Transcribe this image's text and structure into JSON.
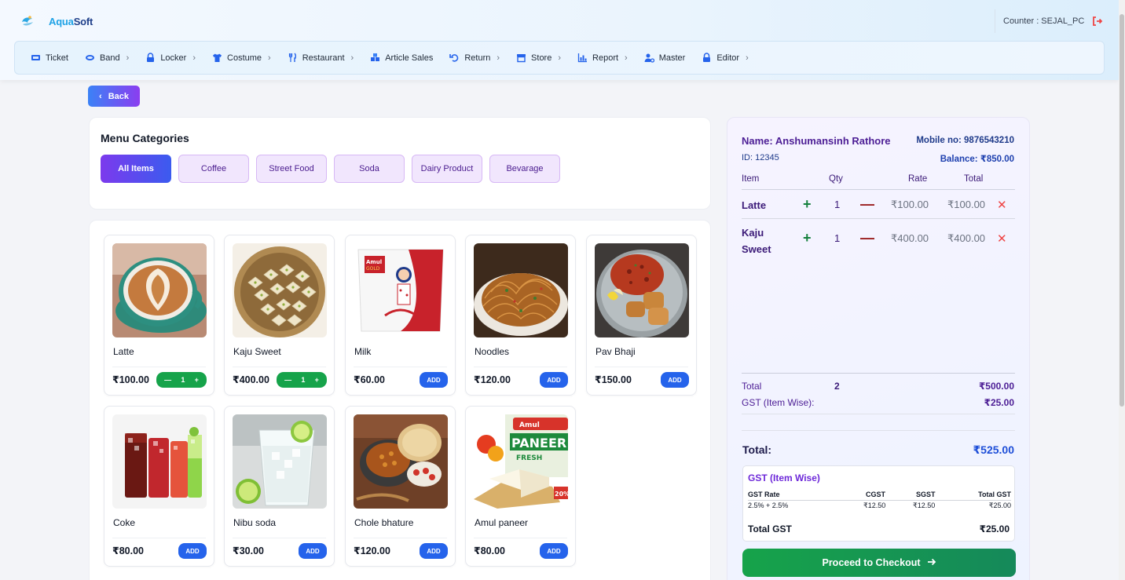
{
  "brand": {
    "aqua": "Aqua",
    "soft": "Soft"
  },
  "counter": {
    "label": "Counter : SEJAL_PC"
  },
  "nav": [
    {
      "label": "Ticket",
      "icon": "ticket-icon",
      "chevron": false
    },
    {
      "label": "Band",
      "icon": "band-icon",
      "chevron": true
    },
    {
      "label": "Locker",
      "icon": "lock-icon",
      "chevron": true
    },
    {
      "label": "Costume",
      "icon": "tshirt-icon",
      "chevron": true
    },
    {
      "label": "Restaurant",
      "icon": "utensils-icon",
      "chevron": true
    },
    {
      "label": "Article Sales",
      "icon": "cubes-icon",
      "chevron": false
    },
    {
      "label": "Return",
      "icon": "undo-icon",
      "chevron": true
    },
    {
      "label": "Store",
      "icon": "store-icon",
      "chevron": true
    },
    {
      "label": "Report",
      "icon": "chart-icon",
      "chevron": true
    },
    {
      "label": "Master",
      "icon": "user-cog-icon",
      "chevron": false
    },
    {
      "label": "Editor",
      "icon": "lock-icon",
      "chevron": true
    }
  ],
  "back": {
    "label": "Back"
  },
  "categories": {
    "title": "Menu Categories",
    "items": [
      "All Items",
      "Coffee",
      "Street Food",
      "Soda",
      "Dairy Product",
      "Bevarage"
    ],
    "active": "All Items"
  },
  "products": [
    {
      "name": "Latte",
      "price": "₹100.00",
      "qty": "1",
      "in_cart": true,
      "image": "latte-image"
    },
    {
      "name": "Kaju Sweet",
      "price": "₹400.00",
      "qty": "1",
      "in_cart": true,
      "image": "kaju-sweet-image"
    },
    {
      "name": "Milk",
      "price": "₹60.00",
      "in_cart": false,
      "add_label": "ADD",
      "image": "milk-packet-image"
    },
    {
      "name": "Noodles",
      "price": "₹120.00",
      "in_cart": false,
      "add_label": "ADD",
      "image": "noodles-image"
    },
    {
      "name": "Pav Bhaji",
      "price": "₹150.00",
      "in_cart": false,
      "add_label": "ADD",
      "image": "pav-bhaji-image"
    },
    {
      "name": "Coke",
      "price": "₹80.00",
      "in_cart": false,
      "add_label": "ADD",
      "image": "coke-glasses-image"
    },
    {
      "name": "Nibu soda",
      "price": "₹30.00",
      "in_cart": false,
      "add_label": "ADD",
      "image": "nibu-soda-image"
    },
    {
      "name": "Chole bhature",
      "price": "₹120.00",
      "in_cart": false,
      "add_label": "ADD",
      "image": "chole-bhature-image"
    },
    {
      "name": "Amul paneer",
      "price": "₹80.00",
      "in_cart": false,
      "add_label": "ADD",
      "image": "amul-paneer-image"
    }
  ],
  "cart": {
    "customer": {
      "name": "Name: Anshumansinh Rathore",
      "mobile": "Mobile no: 9876543210",
      "id": "ID: 12345",
      "balance": "Balance: ₹850.00"
    },
    "headers": {
      "item": "Item",
      "qty": "Qty",
      "rate": "Rate",
      "total": "Total"
    },
    "items": [
      {
        "name": "Latte",
        "qty": "1",
        "rate": "₹100.00",
        "total": "₹100.00"
      },
      {
        "name": "Kaju Sweet",
        "qty": "1",
        "rate": "₹400.00",
        "total": "₹400.00"
      }
    ],
    "summary": {
      "total_label": "Total",
      "total_qty": "2",
      "total_value": "₹500.00",
      "gst_label": "GST (Item Wise):",
      "gst_value": "₹25.00"
    },
    "grand": {
      "label": "Total:",
      "value": "₹525.00"
    },
    "gst_box": {
      "title": "GST (Item Wise)",
      "headers": {
        "rate": "GST Rate",
        "cgst": "CGST",
        "sgst": "SGST",
        "total": "Total GST"
      },
      "row": {
        "rate": "2.5% + 2.5%",
        "cgst": "₹12.50",
        "sgst": "₹12.50",
        "total": "₹25.00"
      },
      "total_label": "Total GST",
      "total_value": "₹25.00"
    },
    "checkout": {
      "label": "Proceed to Checkout"
    }
  },
  "colors": {
    "accent_blue": "#2563eb",
    "accent_green": "#16a34a",
    "accent_purple": "#7c3aed",
    "danger": "#ef4444"
  }
}
